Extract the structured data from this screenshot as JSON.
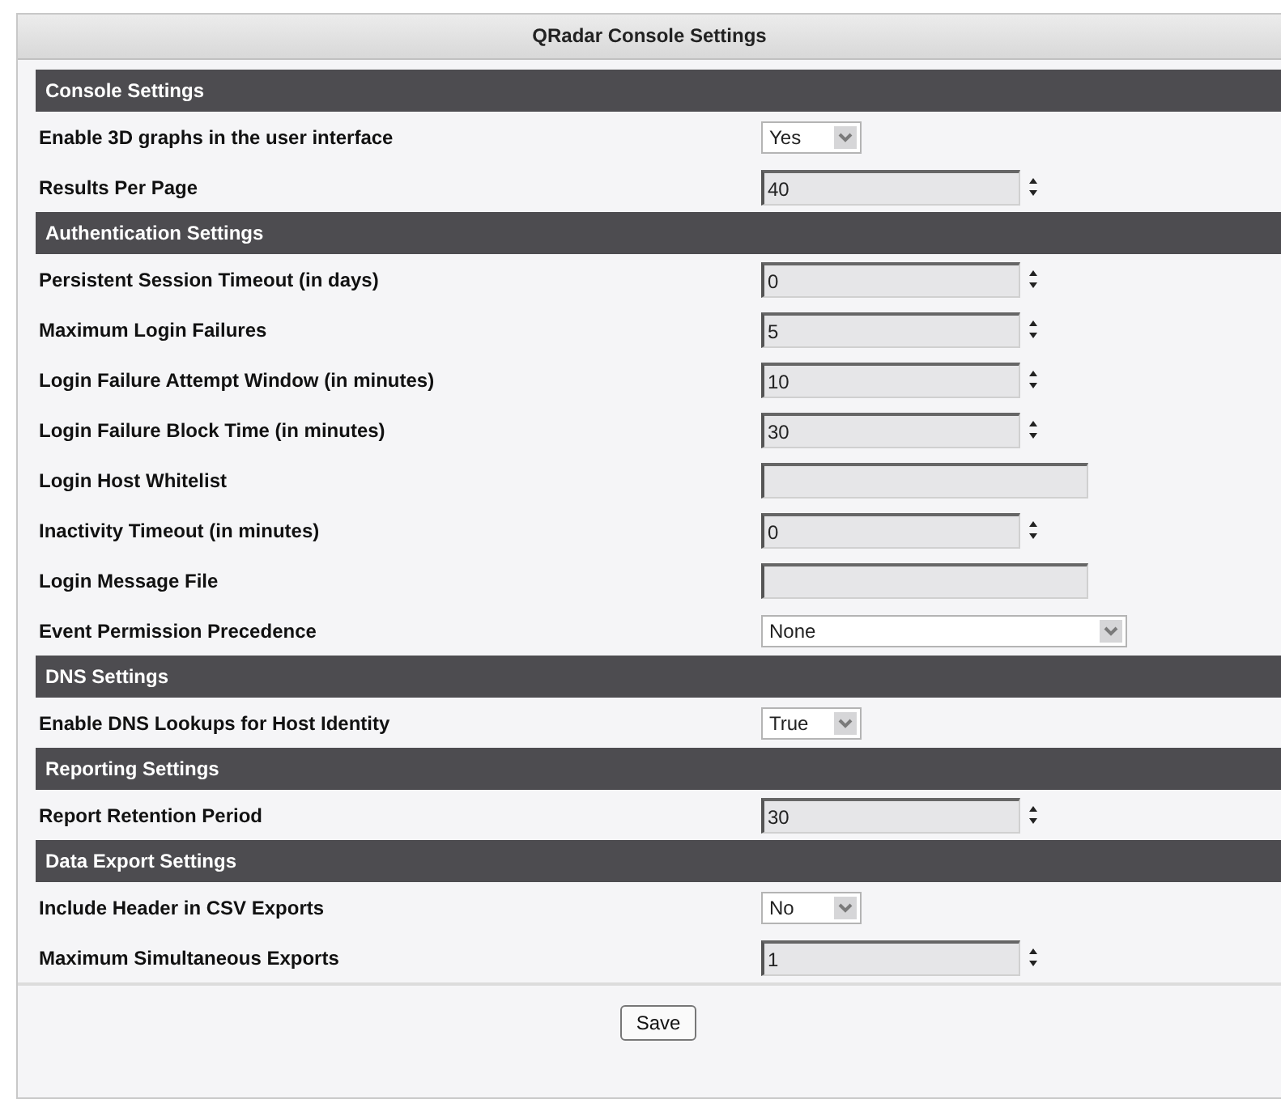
{
  "window": {
    "title": "QRadar Console Settings"
  },
  "sections": [
    {
      "title": "Console Settings",
      "rows": [
        {
          "label": "Enable 3D graphs in the user interface",
          "kind": "short-select",
          "value": "Yes"
        },
        {
          "label": "Results Per Page",
          "kind": "spin",
          "value": "40"
        }
      ]
    },
    {
      "title": "Authentication Settings",
      "rows": [
        {
          "label": "Persistent Session Timeout (in days)",
          "kind": "spin",
          "value": "0"
        },
        {
          "label": "Maximum Login Failures",
          "kind": "spin",
          "value": "5"
        },
        {
          "label": "Login Failure Attempt Window (in minutes)",
          "kind": "spin",
          "value": "10"
        },
        {
          "label": "Login Failure Block Time (in minutes)",
          "kind": "spin",
          "value": "30"
        },
        {
          "label": "Login Host Whitelist",
          "kind": "text"
        },
        {
          "label": "Inactivity Timeout (in minutes)",
          "kind": "spin",
          "value": "0"
        },
        {
          "label": "Login Message File",
          "kind": "text"
        },
        {
          "label": "Event Permission Precedence",
          "kind": "long-select",
          "value": "None"
        }
      ]
    },
    {
      "title": "DNS Settings",
      "rows": [
        {
          "label": "Enable DNS Lookups for Host Identity",
          "kind": "short-select",
          "value": "True"
        }
      ]
    },
    {
      "title": "Reporting Settings",
      "rows": [
        {
          "label": "Report Retention Period",
          "kind": "spin",
          "value": "30"
        }
      ]
    },
    {
      "title": "Data Export Settings",
      "rows": [
        {
          "label": "Include Header in CSV Exports",
          "kind": "short-select",
          "value": "No"
        },
        {
          "label": "Maximum Simultaneous Exports",
          "kind": "spin",
          "value": "1"
        }
      ]
    }
  ],
  "buttons": [
    "Save"
  ]
}
